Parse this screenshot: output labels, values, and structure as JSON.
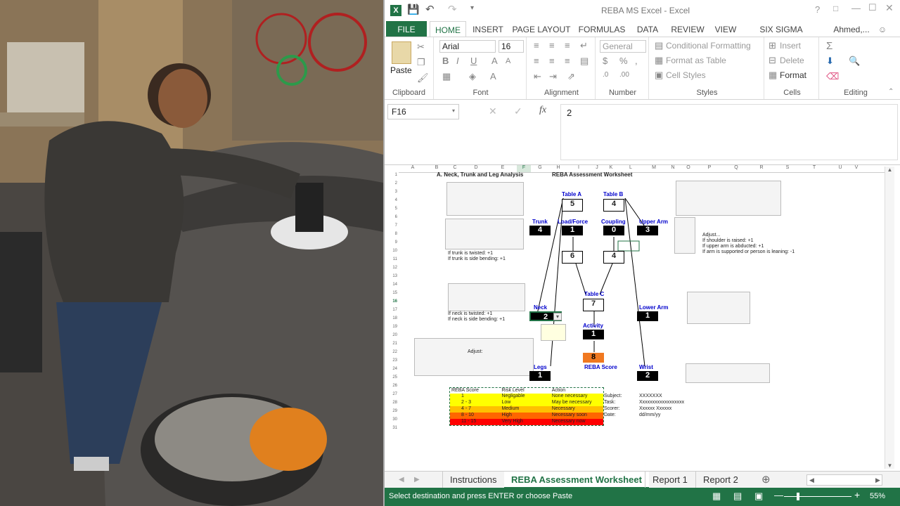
{
  "window": {
    "title": "REBA MS Excel - Excel",
    "user": "Ahmed,..."
  },
  "tabs": [
    "FILE",
    "HOME",
    "INSERT",
    "PAGE LAYOUT",
    "FORMULAS",
    "DATA",
    "REVIEW",
    "VIEW",
    "SIX SIGMA TOOLS"
  ],
  "ribbon": {
    "clipboard": {
      "paste": "Paste",
      "label": "Clipboard"
    },
    "font": {
      "name": "Arial",
      "size": "16",
      "label": "Font"
    },
    "alignment": {
      "label": "Alignment"
    },
    "number": {
      "format": "General",
      "label": "Number"
    },
    "styles": {
      "conditional": "Conditional Formatting",
      "table": "Format as Table",
      "cell": "Cell Styles",
      "label": "Styles"
    },
    "cells": {
      "insert": "Insert",
      "delete": "Delete",
      "format": "Format",
      "label": "Cells"
    },
    "editing": {
      "label": "Editing"
    }
  },
  "formula_bar": {
    "name_box": "F16",
    "fx": "fx",
    "value": "2"
  },
  "columns": [
    "A",
    "B",
    "C",
    "D",
    "E",
    "F",
    "G",
    "H",
    "I",
    "J",
    "K",
    "L",
    "M",
    "N",
    "O",
    "P",
    "Q",
    "R",
    "S",
    "T",
    "U",
    "V"
  ],
  "rows": [
    "1",
    "2",
    "3",
    "4",
    "5",
    "6",
    "7",
    "8",
    "9",
    "10",
    "11",
    "12",
    "13",
    "14",
    "15",
    "16",
    "17",
    "18",
    "19",
    "20",
    "21",
    "22",
    "23",
    "24",
    "25",
    "26",
    "27",
    "28",
    "29",
    "30",
    "31"
  ],
  "worksheet": {
    "section_a": "A. Neck, Trunk and Leg Analysis",
    "title": "REBA Assessment Worksheet",
    "table_a": "Table A",
    "table_a_val": "5",
    "table_b": "Table B",
    "table_b_val": "4",
    "table_c": "Table C",
    "table_c_val": "7",
    "trunk": "Trunk",
    "trunk_val": "4",
    "load_force": "Load/Force",
    "load_force_val": "1",
    "coupling": "Coupling",
    "coupling_val": "0",
    "upper_arm": "Upper Arm",
    "upper_arm_val": "3",
    "sum_a": "6",
    "sum_b": "4",
    "neck": "Neck",
    "neck_val": "2",
    "lower_arm": "Lower Arm",
    "lower_arm_val": "1",
    "activity": "Activity",
    "activity_val": "1",
    "reba_score_val": "8",
    "reba_score": "REBA Score",
    "legs": "Legs",
    "legs_val": "1",
    "wrist": "Wrist",
    "wrist_val": "2",
    "trunk_notes": [
      "If trunk is twisted: +1",
      "If trunk is side bending: +1"
    ],
    "neck_notes": [
      "If neck is twisted: +1",
      "If neck is side bending: +1"
    ],
    "upper_arm_notes": [
      "Adjust...",
      "If shoulder is raised: +1",
      "If upper arm is abducted: +1",
      "If arm is supported or person is leaning: -1"
    ],
    "legs_adjust": "Adjust:"
  },
  "risk_table": {
    "headers": [
      "REBA Score",
      "Risk Level",
      "Action"
    ],
    "rows": [
      {
        "score": "1",
        "level": "Negligable",
        "action": "None necessary",
        "color": "#ffff00"
      },
      {
        "score": "2 - 3",
        "level": "Low",
        "action": "May be necessary",
        "color": "#ffff00"
      },
      {
        "score": "4 - 7",
        "level": "Medium",
        "action": "Necessary",
        "color": "#ffc000"
      },
      {
        "score": "8 - 10",
        "level": "High",
        "action": "Necessary soon",
        "color": "#ff6600"
      },
      {
        "score": "11 - 15",
        "level": "Very High",
        "action": "Necessary now",
        "color": "#ff0000"
      }
    ]
  },
  "info": {
    "subject_label": "Subject:",
    "subject": "XXXXXXX",
    "task_label": "Task:",
    "task": "Xxxxxxxxxxxxxxxxxx",
    "scorer_label": "Scorer:",
    "scorer": "Xxxxxx Xxxxxx",
    "date_label": "Date:",
    "date": "dd/mm/yy"
  },
  "sheet_tabs": [
    "Instructions",
    "REBA Assessment Worksheet",
    "Report 1",
    "Report 2"
  ],
  "status": {
    "message": "Select destination and press ENTER or choose Paste",
    "zoom": "55%"
  },
  "colors": {
    "accent": "#217346",
    "tab_active": "#217346"
  }
}
